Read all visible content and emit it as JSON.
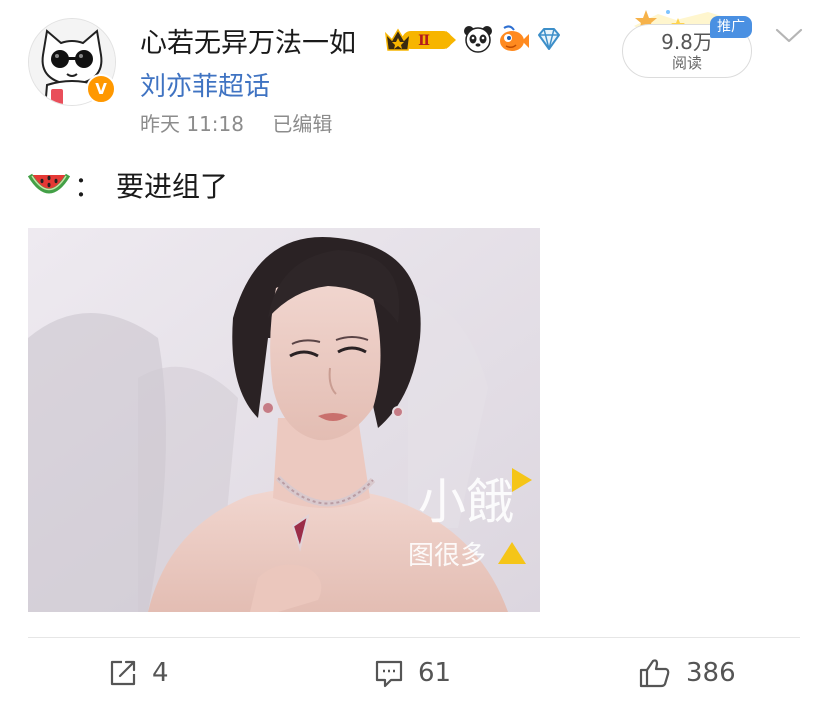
{
  "user": {
    "username": "心若无异万法一如",
    "verified_mark": "V",
    "badges": [
      "crown-level-badge",
      "panda-badge",
      "fish-badge",
      "diamond-badge"
    ],
    "level_badge_text": "Ⅱ"
  },
  "supertopic": "刘亦菲超话",
  "meta": {
    "time": "昨天 11:18",
    "edited": "已编辑"
  },
  "stats": {
    "reads": "9.8万",
    "reads_label": "阅读",
    "promo_tag": "推广"
  },
  "post": {
    "emoji_icon": "watermelon-icon",
    "colon": "：",
    "text": "要进组了",
    "watermark_line1": "小餓",
    "watermark_line2": "图很多"
  },
  "actions": {
    "reposts": "4",
    "comments": "61",
    "likes": "386"
  },
  "colors": {
    "link_blue": "#3f73c2",
    "promo_blue": "#4a90e2",
    "verified_orange": "#ff9800",
    "meta_gray": "#8c8c8c"
  }
}
